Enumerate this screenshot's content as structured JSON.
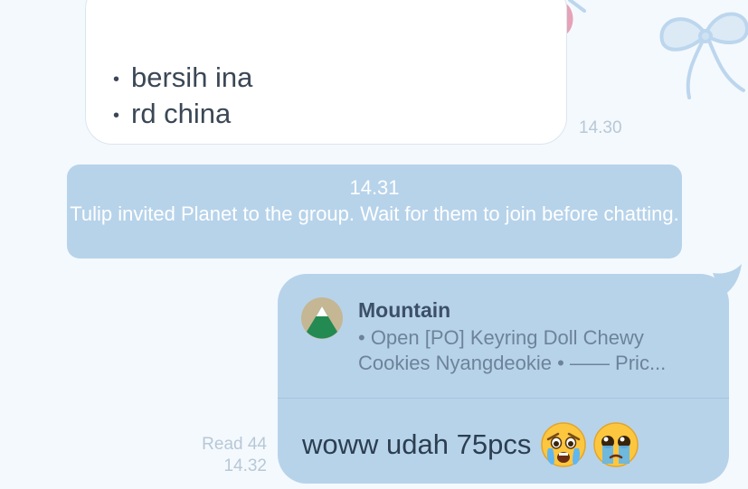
{
  "chat": {
    "incoming_message": {
      "items": [
        "bersih ina",
        "rd china"
      ],
      "time": "14.30"
    },
    "system_notice": {
      "time": "14.31",
      "text": "Tulip invited Planet to the group. Wait for them to join before chatting."
    },
    "outgoing_message": {
      "reply_preview": {
        "name": "Mountain",
        "text": "• Open [PO] Keyring Doll Chewy Cookies Nyangdeokie • —— Pric..."
      },
      "text": "woww udah 75pcs",
      "emojis": [
        "crying-face-emoji",
        "pleading-tears-face-emoji"
      ],
      "read_label": "Read 44",
      "time": "14.32"
    }
  },
  "colors": {
    "background": "#f4f9fd",
    "bubble_blue": "#b7d3ea",
    "timestamp": "#b7c8d6",
    "ribbon": "#bcd6ee"
  }
}
